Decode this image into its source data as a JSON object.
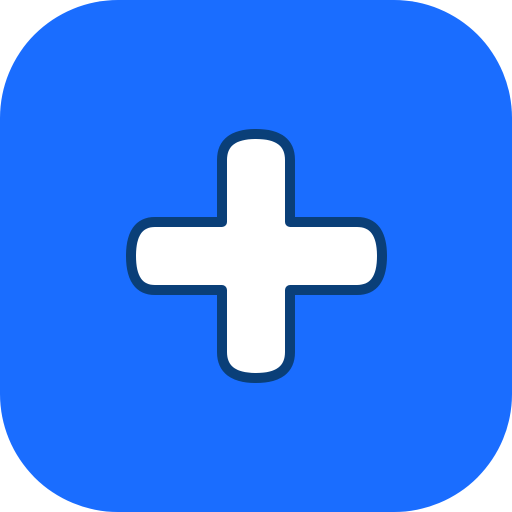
{
  "icon": {
    "name": "plus-icon",
    "background_name": "rounded-square-tile",
    "colors": {
      "tile": "#1a6dff",
      "plus_fill": "#ffffff",
      "plus_stroke": "#0a3f78",
      "page": "#ffffff"
    }
  }
}
